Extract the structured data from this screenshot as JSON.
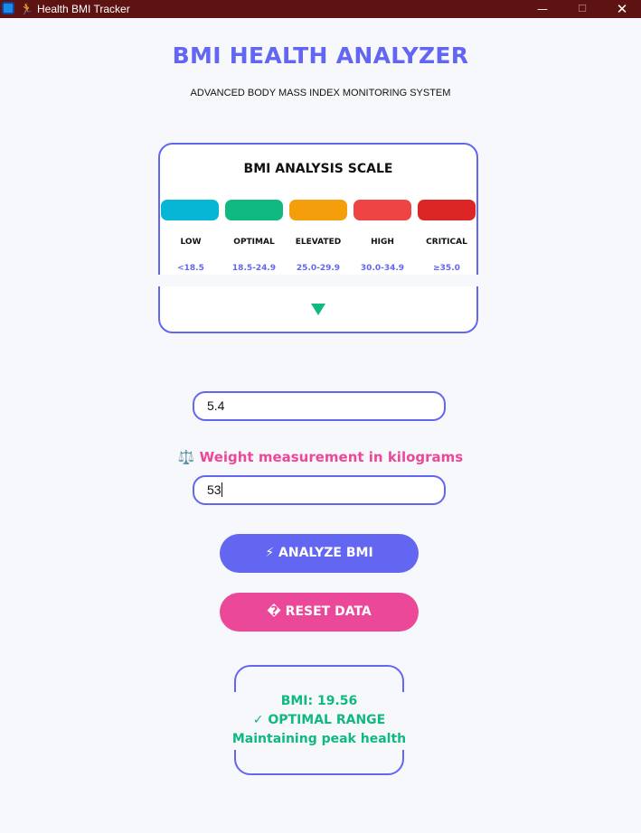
{
  "window": {
    "emoji": "🏃",
    "title": "Health BMI Tracker",
    "minimize": "—",
    "maximize": "☐",
    "close": "✕"
  },
  "header": {
    "title": "BMI HEALTH ANALYZER",
    "subtitle": "ADVANCED BODY MASS INDEX MONITORING SYSTEM"
  },
  "scale": {
    "title": "BMI ANALYSIS SCALE",
    "categories": [
      {
        "label": "LOW",
        "range": "<18.5",
        "color": "#06b6d4"
      },
      {
        "label": "OPTIMAL",
        "range": "18.5-24.9",
        "color": "#10b981"
      },
      {
        "label": "ELEVATED",
        "range": "25.0-29.9",
        "color": "#f59e0b"
      },
      {
        "label": "HIGH",
        "range": "30.0-34.9",
        "color": "#ef4444"
      },
      {
        "label": "CRITICAL",
        "range": "≥35.0",
        "color": "#dc2626"
      }
    ],
    "indicator_color": "#10b981",
    "indicator_category": "OPTIMAL"
  },
  "inputs": {
    "height_value": "5.4",
    "weight_label": "⚖️ Weight measurement in kilograms",
    "weight_value": "53"
  },
  "buttons": {
    "analyze": "⚡ ANALYZE BMI",
    "reset": "� RESET DATA"
  },
  "result": {
    "bmi": "BMI: 19.56",
    "status": "✓ OPTIMAL RANGE",
    "message": "Maintaining peak health",
    "color": "#10b981"
  },
  "colors": {
    "accent": "#6366f1",
    "pink": "#ec4899",
    "titlebar": "#5e1313",
    "background": "#f7f8fb"
  }
}
